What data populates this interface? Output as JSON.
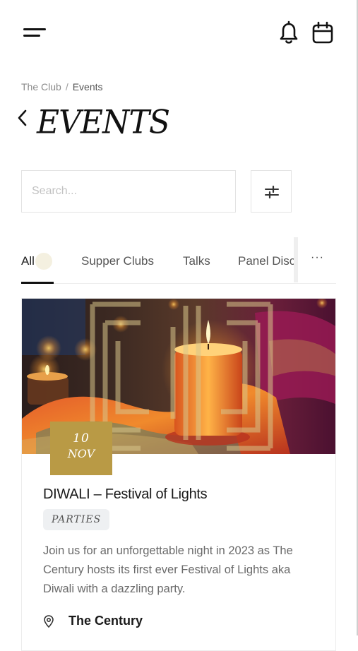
{
  "breadcrumb": {
    "parent": "The Club",
    "separator": "/",
    "current": "Events"
  },
  "page": {
    "title": "EVENTS"
  },
  "search": {
    "placeholder": "Search..."
  },
  "tabs": [
    {
      "label": "All",
      "active": true
    },
    {
      "label": "Supper Clubs",
      "active": false
    },
    {
      "label": "Talks",
      "active": false
    },
    {
      "label": "Panel Disc",
      "active": false
    }
  ],
  "tabs_more": "···",
  "icons": {
    "menu": "hamburger-icon",
    "notifications": "bell-icon",
    "calendar": "calendar-icon",
    "back": "chevron-left-icon",
    "filter": "sliders-icon",
    "location": "map-pin-icon"
  },
  "colors": {
    "accent_gold": "#b99a45",
    "text_dark": "#1a1a1a",
    "muted": "#6a6a6a",
    "tag_bg": "#eef0f2"
  },
  "event": {
    "day": "10",
    "month": "NOV",
    "title": "DIWALI – Festival of Lights",
    "category": "PARTIES",
    "description": "Join us for an unforgettable night in 2023 as The Century hosts its first ever Festival of Lights aka Diwali with a dazzling party.",
    "location": "The Century"
  }
}
